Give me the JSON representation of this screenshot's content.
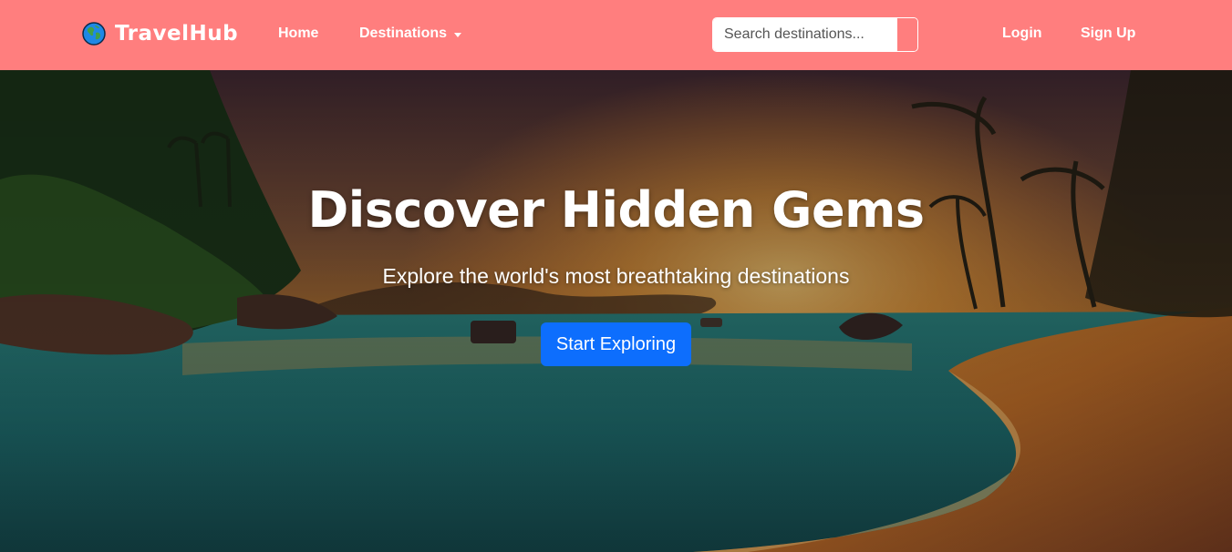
{
  "navbar": {
    "brand": "TravelHub",
    "brand_icon": "globe-icon",
    "background_color": "#ff7e7e",
    "links": {
      "home": "Home",
      "destinations": "Destinations",
      "login": "Login",
      "signup": "Sign Up"
    },
    "search": {
      "placeholder": "Search destinations...",
      "value": ""
    }
  },
  "hero": {
    "title": "Discover Hidden Gems",
    "subtitle": "Explore the world's most breathtaking destinations",
    "cta_label": "Start Exploring",
    "cta_color": "#0d6efd"
  }
}
